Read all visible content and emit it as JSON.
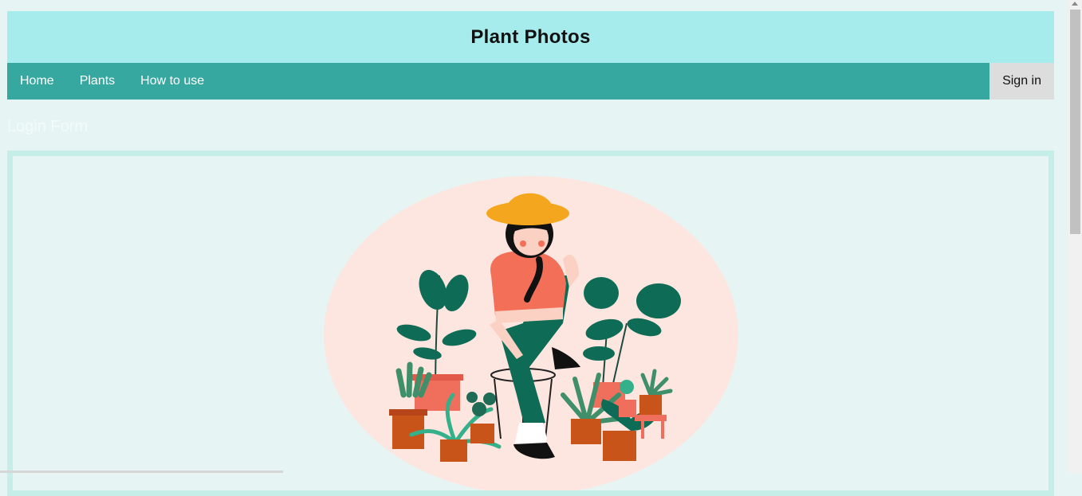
{
  "header": {
    "title": "Plant Photos"
  },
  "nav": {
    "items": [
      {
        "label": "Home"
      },
      {
        "label": "Plants"
      },
      {
        "label": "How to use"
      }
    ],
    "signin_label": "Sign in"
  },
  "main": {
    "faint_heading": "Login Form"
  },
  "colors": {
    "background": "#e6f4f4",
    "header": "#a6ecec",
    "nav": "#36a8a0",
    "signin": "#dddddd",
    "frame_border": "#c6eee8"
  },
  "illustration": {
    "icon": "plant-lady-illustration"
  }
}
